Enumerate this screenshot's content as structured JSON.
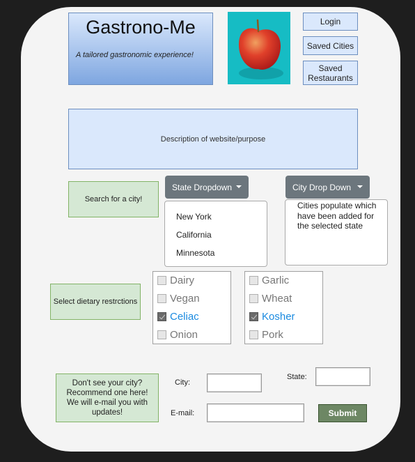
{
  "header": {
    "title": "Gastrono-Me",
    "tagline": "A tailored gastronomic experience!"
  },
  "hero_image": {
    "subject": "apple-image",
    "alt": "Red apple on teal background"
  },
  "nav": {
    "login": "Login",
    "saved_cities": "Saved Cities",
    "saved_restaurants": "Saved Restaurants"
  },
  "description": "Description of website/purpose",
  "search": {
    "prompt": "Search for a city!",
    "state_dropdown": {
      "label": "State Dropdown",
      "options": [
        "New York",
        "California",
        "Minnesota"
      ]
    },
    "city_dropdown": {
      "label": "City Drop Down",
      "note": "Cities populate which have been added for the selected state"
    }
  },
  "dietary": {
    "prompt": "Select dietary restrctions",
    "group1": [
      {
        "label": "Dairy",
        "checked": false
      },
      {
        "label": "Vegan",
        "checked": false
      },
      {
        "label": "Celiac",
        "checked": true
      },
      {
        "label": "Onion",
        "checked": false
      }
    ],
    "group2": [
      {
        "label": "Garlic",
        "checked": false
      },
      {
        "label": "Wheat",
        "checked": false
      },
      {
        "label": "Kosher",
        "checked": true
      },
      {
        "label": "Pork",
        "checked": false
      }
    ]
  },
  "recommend": {
    "prompt": "Don't see your city? Recommend one here! We will e-mail you with updates!",
    "city_label": "City:",
    "state_label": "State:",
    "email_label": "E-mail:",
    "city_value": "",
    "state_value": "",
    "email_value": "",
    "submit_label": "Submit"
  },
  "colors": {
    "background": "#1e1e1e",
    "card": "#f4f4f4",
    "blue_fill": "#dae8fc",
    "blue_border": "#6c8ebf",
    "green_fill": "#d5e8d4",
    "green_border": "#82b366",
    "dropdown_button": "#6c767d",
    "checked_label": "#1a8ae0",
    "submit_button": "#6d8764"
  }
}
